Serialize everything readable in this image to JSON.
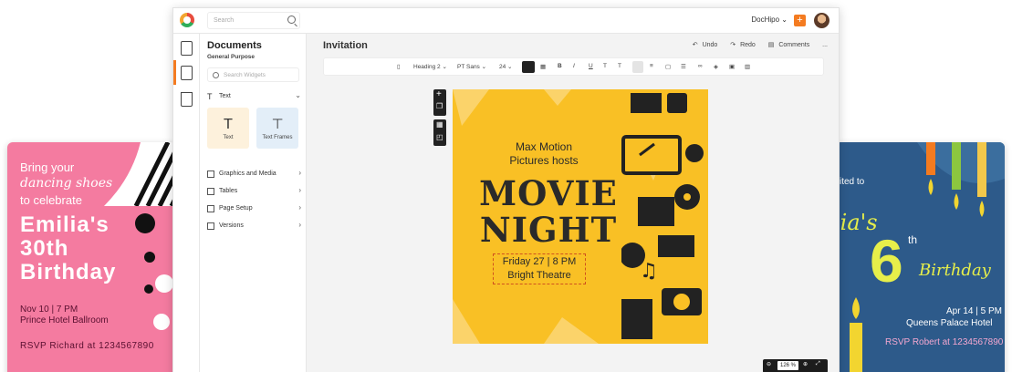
{
  "left_card": {
    "line1": "Bring your",
    "line2": "dancing shoes",
    "line3": "to celebrate",
    "name": "Emilia's",
    "age": "30th",
    "occasion": "Birthday",
    "date": "Nov 10 | 7 PM",
    "place": "Prince Hotel Ballroom",
    "rsvp": "RSVP Richard at 1234567890"
  },
  "right_card": {
    "invited": "vited to",
    "name": "lia's",
    "age": "6",
    "suffix": "th",
    "occasion": "Birthday",
    "date": "Apr 14 | 5 PM",
    "place": "Queens Palace Hotel",
    "rsvp": "RSVP Robert at 1234567890"
  },
  "topbar": {
    "search_placeholder": "Search",
    "brand_menu": "DocHipo",
    "plus": "+"
  },
  "panel": {
    "title": "Documents",
    "subtitle": "General Purpose",
    "widget_search_placeholder": "Search Widgets",
    "text_section": "Text",
    "tile_text_label": "Text",
    "tile_frames_label": "Text Frames",
    "items": [
      {
        "label": "Graphics and Media"
      },
      {
        "label": "Tables"
      },
      {
        "label": "Page Setup"
      },
      {
        "label": "Versions"
      }
    ]
  },
  "workspace": {
    "doc_title": "Invitation",
    "undo": "Undo",
    "redo": "Redo",
    "comments": "Comments",
    "more": "...",
    "toolbar": {
      "style": "Heading 2",
      "font": "PT Sans",
      "size": "24"
    }
  },
  "poster": {
    "host_line1": "Max Motion",
    "host_line2": "Pictures hosts",
    "title1": "MOVIE",
    "title2": "NIGHT",
    "date": "Friday 27 | 8 PM",
    "place": "Bright Theatre",
    "bg_color": "#f9c025"
  },
  "zoom": {
    "value": "126 %"
  },
  "colors": {
    "accent": "#f47b20",
    "left_card_bg": "#f47ba0",
    "right_card_bg": "#2d5a8a"
  }
}
